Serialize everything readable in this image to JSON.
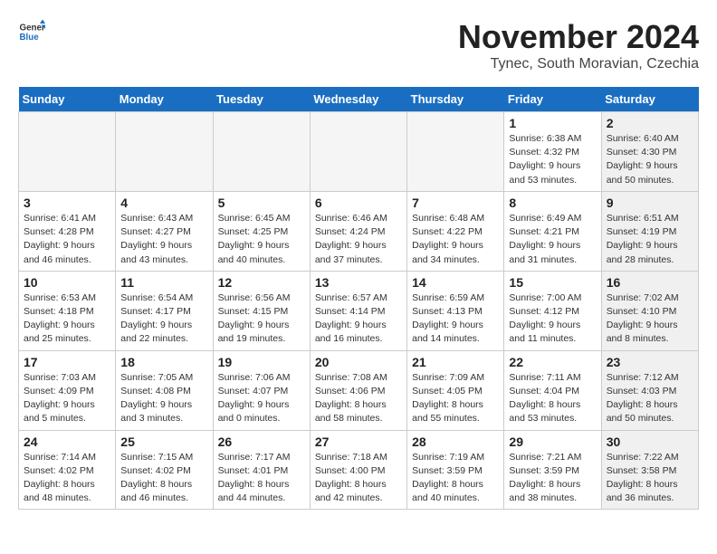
{
  "header": {
    "logo_general": "General",
    "logo_blue": "Blue",
    "month_year": "November 2024",
    "location": "Tynec, South Moravian, Czechia"
  },
  "weekdays": [
    "Sunday",
    "Monday",
    "Tuesday",
    "Wednesday",
    "Thursday",
    "Friday",
    "Saturday"
  ],
  "weeks": [
    [
      {
        "day": "",
        "info": "",
        "empty": true
      },
      {
        "day": "",
        "info": "",
        "empty": true
      },
      {
        "day": "",
        "info": "",
        "empty": true
      },
      {
        "day": "",
        "info": "",
        "empty": true
      },
      {
        "day": "",
        "info": "",
        "empty": true
      },
      {
        "day": "1",
        "info": "Sunrise: 6:38 AM\nSunset: 4:32 PM\nDaylight: 9 hours\nand 53 minutes.",
        "shaded": false
      },
      {
        "day": "2",
        "info": "Sunrise: 6:40 AM\nSunset: 4:30 PM\nDaylight: 9 hours\nand 50 minutes.",
        "shaded": true
      }
    ],
    [
      {
        "day": "3",
        "info": "Sunrise: 6:41 AM\nSunset: 4:28 PM\nDaylight: 9 hours\nand 46 minutes.",
        "shaded": false
      },
      {
        "day": "4",
        "info": "Sunrise: 6:43 AM\nSunset: 4:27 PM\nDaylight: 9 hours\nand 43 minutes.",
        "shaded": false
      },
      {
        "day": "5",
        "info": "Sunrise: 6:45 AM\nSunset: 4:25 PM\nDaylight: 9 hours\nand 40 minutes.",
        "shaded": false
      },
      {
        "day": "6",
        "info": "Sunrise: 6:46 AM\nSunset: 4:24 PM\nDaylight: 9 hours\nand 37 minutes.",
        "shaded": false
      },
      {
        "day": "7",
        "info": "Sunrise: 6:48 AM\nSunset: 4:22 PM\nDaylight: 9 hours\nand 34 minutes.",
        "shaded": false
      },
      {
        "day": "8",
        "info": "Sunrise: 6:49 AM\nSunset: 4:21 PM\nDaylight: 9 hours\nand 31 minutes.",
        "shaded": false
      },
      {
        "day": "9",
        "info": "Sunrise: 6:51 AM\nSunset: 4:19 PM\nDaylight: 9 hours\nand 28 minutes.",
        "shaded": true
      }
    ],
    [
      {
        "day": "10",
        "info": "Sunrise: 6:53 AM\nSunset: 4:18 PM\nDaylight: 9 hours\nand 25 minutes.",
        "shaded": false
      },
      {
        "day": "11",
        "info": "Sunrise: 6:54 AM\nSunset: 4:17 PM\nDaylight: 9 hours\nand 22 minutes.",
        "shaded": false
      },
      {
        "day": "12",
        "info": "Sunrise: 6:56 AM\nSunset: 4:15 PM\nDaylight: 9 hours\nand 19 minutes.",
        "shaded": false
      },
      {
        "day": "13",
        "info": "Sunrise: 6:57 AM\nSunset: 4:14 PM\nDaylight: 9 hours\nand 16 minutes.",
        "shaded": false
      },
      {
        "day": "14",
        "info": "Sunrise: 6:59 AM\nSunset: 4:13 PM\nDaylight: 9 hours\nand 14 minutes.",
        "shaded": false
      },
      {
        "day": "15",
        "info": "Sunrise: 7:00 AM\nSunset: 4:12 PM\nDaylight: 9 hours\nand 11 minutes.",
        "shaded": false
      },
      {
        "day": "16",
        "info": "Sunrise: 7:02 AM\nSunset: 4:10 PM\nDaylight: 9 hours\nand 8 minutes.",
        "shaded": true
      }
    ],
    [
      {
        "day": "17",
        "info": "Sunrise: 7:03 AM\nSunset: 4:09 PM\nDaylight: 9 hours\nand 5 minutes.",
        "shaded": false
      },
      {
        "day": "18",
        "info": "Sunrise: 7:05 AM\nSunset: 4:08 PM\nDaylight: 9 hours\nand 3 minutes.",
        "shaded": false
      },
      {
        "day": "19",
        "info": "Sunrise: 7:06 AM\nSunset: 4:07 PM\nDaylight: 9 hours\nand 0 minutes.",
        "shaded": false
      },
      {
        "day": "20",
        "info": "Sunrise: 7:08 AM\nSunset: 4:06 PM\nDaylight: 8 hours\nand 58 minutes.",
        "shaded": false
      },
      {
        "day": "21",
        "info": "Sunrise: 7:09 AM\nSunset: 4:05 PM\nDaylight: 8 hours\nand 55 minutes.",
        "shaded": false
      },
      {
        "day": "22",
        "info": "Sunrise: 7:11 AM\nSunset: 4:04 PM\nDaylight: 8 hours\nand 53 minutes.",
        "shaded": false
      },
      {
        "day": "23",
        "info": "Sunrise: 7:12 AM\nSunset: 4:03 PM\nDaylight: 8 hours\nand 50 minutes.",
        "shaded": true
      }
    ],
    [
      {
        "day": "24",
        "info": "Sunrise: 7:14 AM\nSunset: 4:02 PM\nDaylight: 8 hours\nand 48 minutes.",
        "shaded": false
      },
      {
        "day": "25",
        "info": "Sunrise: 7:15 AM\nSunset: 4:02 PM\nDaylight: 8 hours\nand 46 minutes.",
        "shaded": false
      },
      {
        "day": "26",
        "info": "Sunrise: 7:17 AM\nSunset: 4:01 PM\nDaylight: 8 hours\nand 44 minutes.",
        "shaded": false
      },
      {
        "day": "27",
        "info": "Sunrise: 7:18 AM\nSunset: 4:00 PM\nDaylight: 8 hours\nand 42 minutes.",
        "shaded": false
      },
      {
        "day": "28",
        "info": "Sunrise: 7:19 AM\nSunset: 3:59 PM\nDaylight: 8 hours\nand 40 minutes.",
        "shaded": false
      },
      {
        "day": "29",
        "info": "Sunrise: 7:21 AM\nSunset: 3:59 PM\nDaylight: 8 hours\nand 38 minutes.",
        "shaded": false
      },
      {
        "day": "30",
        "info": "Sunrise: 7:22 AM\nSunset: 3:58 PM\nDaylight: 8 hours\nand 36 minutes.",
        "shaded": true
      }
    ]
  ]
}
